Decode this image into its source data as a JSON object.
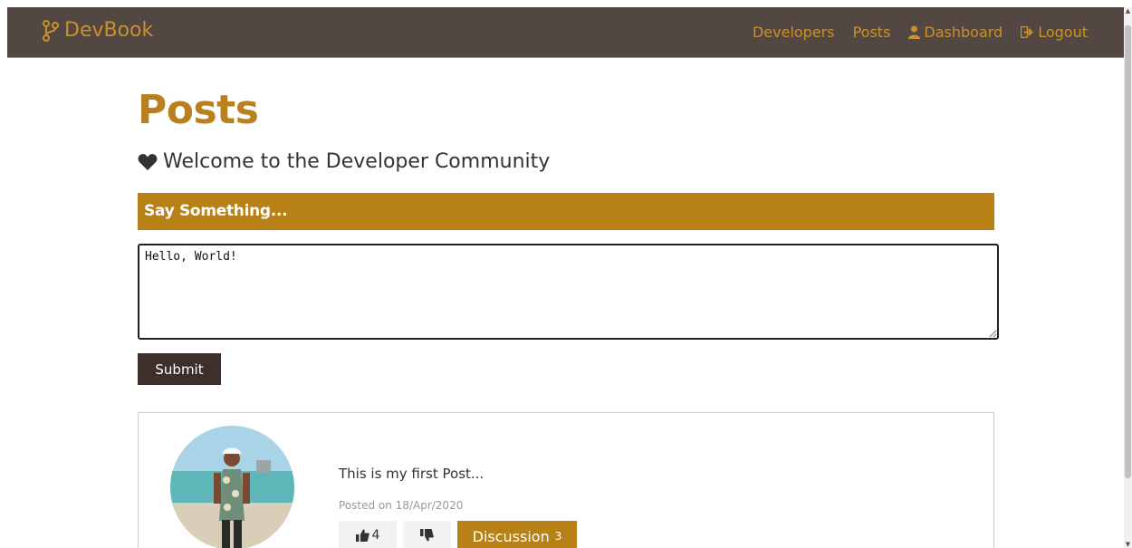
{
  "navbar": {
    "brand": "DevBook",
    "links": {
      "developers": "Developers",
      "posts": "Posts",
      "dashboard": "Dashboard",
      "logout": "Logout"
    }
  },
  "page": {
    "title": "Posts",
    "lead": "Welcome to the Developer Community"
  },
  "post_form": {
    "header": "Say Something...",
    "textarea_value": "Hello, World!",
    "submit_label": "Submit"
  },
  "posts": [
    {
      "text": "This is my first Post...",
      "date": "Posted on 18/Apr/2020",
      "likes": "4",
      "discussion_label": "Discussion",
      "discussion_count": "3"
    }
  ],
  "colors": {
    "navbar_bg": "#524742",
    "accent": "#b88117",
    "submit_bg": "#3d302c"
  }
}
